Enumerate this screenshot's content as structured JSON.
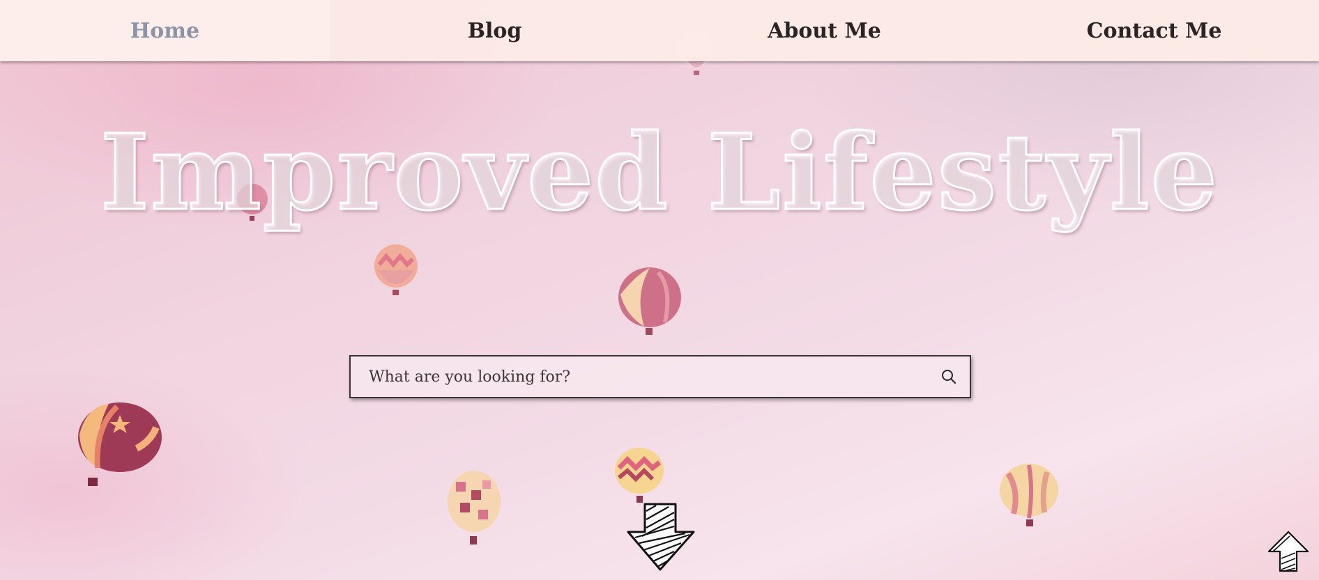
{
  "nav": {
    "items": [
      {
        "label": "Home",
        "active": true
      },
      {
        "label": "Blog",
        "active": false
      },
      {
        "label": "About Me",
        "active": false
      },
      {
        "label": "Contact Me",
        "active": false
      }
    ]
  },
  "hero": {
    "title": "Improved Lifestyle"
  },
  "search": {
    "placeholder": "What are you looking for?",
    "icon": "search-icon"
  },
  "icons": {
    "scroll_down": "down-arrow-icon",
    "back_to_top": "up-arrow-icon"
  },
  "colors": {
    "nav_background": "#fdece6",
    "nav_text": "#2b2424",
    "nav_active": "#8c95a8",
    "hero_text": "#ffffff",
    "background": "#f0d3df"
  }
}
